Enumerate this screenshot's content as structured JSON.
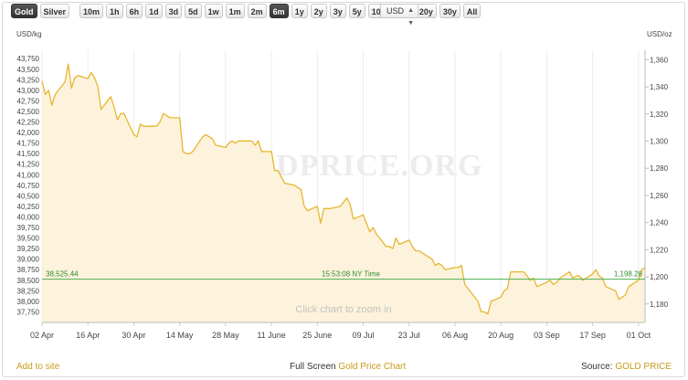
{
  "toolbar": {
    "metals": [
      {
        "label": "Gold",
        "active": true
      },
      {
        "label": "Silver",
        "active": false
      }
    ],
    "ranges": [
      {
        "label": "10m",
        "active": false
      },
      {
        "label": "1h",
        "active": false
      },
      {
        "label": "6h",
        "active": false
      },
      {
        "label": "1d",
        "active": false
      },
      {
        "label": "3d",
        "active": false
      },
      {
        "label": "5d",
        "active": false
      },
      {
        "label": "1w",
        "active": false
      },
      {
        "label": "1m",
        "active": false
      },
      {
        "label": "2m",
        "active": false
      },
      {
        "label": "6m",
        "active": true
      },
      {
        "label": "1y",
        "active": false
      },
      {
        "label": "2y",
        "active": false
      },
      {
        "label": "3y",
        "active": false
      },
      {
        "label": "5y",
        "active": false
      },
      {
        "label": "10y",
        "active": false
      },
      {
        "label": "15y",
        "active": false
      },
      {
        "label": "20y",
        "active": false
      },
      {
        "label": "30y",
        "active": false
      },
      {
        "label": "All",
        "active": false
      }
    ],
    "currency": "USD"
  },
  "footer": {
    "add_to_site": "Add to site",
    "full_screen": "Full Screen",
    "chart_link": "Gold Price Chart",
    "source_label": "Source:",
    "source_name": "GOLD PRICE"
  },
  "colors": {
    "line": "#e8b530",
    "fill": "#fdf3dc",
    "crosshair": "#4caf50",
    "crosshair_text": "#2e8b2e",
    "link": "#c79a1e",
    "watermark": "#ececec"
  },
  "chart_data": {
    "type": "area",
    "watermark": "GOLDPRICE.ORG",
    "hint": "Click chart to zoom in",
    "left_axis": {
      "unit": "USD/kg",
      "range": [
        37500,
        43950
      ],
      "ticks": [
        37750,
        38000,
        38250,
        38500,
        38750,
        39000,
        39250,
        39500,
        39750,
        40000,
        40250,
        40500,
        40750,
        41000,
        41250,
        41500,
        41750,
        42000,
        42250,
        42500,
        42750,
        43000,
        43250,
        43500,
        43750
      ],
      "tick_labels": [
        "37,750",
        "38,000",
        "38,250",
        "38,500",
        "38,750",
        "39,000",
        "39,250",
        "39,500",
        "39,750",
        "40,000",
        "40,250",
        "40,500",
        "40,750",
        "41,000",
        "41,250",
        "41,500",
        "41,750",
        "42,000",
        "42,250",
        "42,500",
        "42,750",
        "43,000",
        "43,250",
        "43,500",
        "43,750"
      ]
    },
    "right_axis": {
      "unit": "USD/oz",
      "ticks": [
        1180,
        1200,
        1220,
        1240,
        1260,
        1280,
        1300,
        1320,
        1340,
        1360
      ],
      "tick_labels": [
        "1,180",
        "1,200",
        "1,220",
        "1,240",
        "1,260",
        "1,280",
        "1,300",
        "1,320",
        "1,340",
        "1,360"
      ]
    },
    "x_axis": {
      "range": [
        "2018-04-02",
        "2018-10-03"
      ],
      "ticks": [
        "2018-04-02",
        "2018-04-16",
        "2018-04-30",
        "2018-05-14",
        "2018-05-28",
        "2018-06-11",
        "2018-06-25",
        "2018-07-09",
        "2018-07-23",
        "2018-08-06",
        "2018-08-20",
        "2018-09-03",
        "2018-09-17",
        "2018-10-01"
      ],
      "tick_labels": [
        "02 Apr",
        "16 Apr",
        "30 Apr",
        "14 May",
        "28 May",
        "11 June",
        "25 June",
        "09 Jul",
        "23 Jul",
        "06 Aug",
        "20 Aug",
        "03 Sep",
        "17 Sep",
        "01 Oct"
      ]
    },
    "grid": "vertical",
    "crosshair": {
      "left_label": "38,525.44",
      "time_label": "15:53:08 NY Time",
      "right_label": "1,198.28",
      "value": 38525.44
    },
    "series": [
      {
        "x": [
          "2018-04-02",
          "2018-04-03",
          "2018-04-04",
          "2018-04-05",
          "2018-04-06",
          "2018-04-09",
          "2018-04-10",
          "2018-04-11",
          "2018-04-12",
          "2018-04-13",
          "2018-04-16",
          "2018-04-17",
          "2018-04-18",
          "2018-04-19",
          "2018-04-20",
          "2018-04-23",
          "2018-04-24",
          "2018-04-25",
          "2018-04-26",
          "2018-04-27",
          "2018-04-30",
          "2018-05-01",
          "2018-05-02",
          "2018-05-03",
          "2018-05-04",
          "2018-05-07",
          "2018-05-08",
          "2018-05-09",
          "2018-05-10",
          "2018-05-11",
          "2018-05-14",
          "2018-05-15",
          "2018-05-16",
          "2018-05-17",
          "2018-05-18",
          "2018-05-21",
          "2018-05-22",
          "2018-05-23",
          "2018-05-24",
          "2018-05-25",
          "2018-05-28",
          "2018-05-29",
          "2018-05-30",
          "2018-05-31",
          "2018-06-01",
          "2018-06-04",
          "2018-06-05",
          "2018-06-06",
          "2018-06-07",
          "2018-06-08",
          "2018-06-11",
          "2018-06-12",
          "2018-06-13",
          "2018-06-14",
          "2018-06-15",
          "2018-06-18",
          "2018-06-19",
          "2018-06-20",
          "2018-06-21",
          "2018-06-22",
          "2018-06-25",
          "2018-06-26",
          "2018-06-27",
          "2018-06-28",
          "2018-06-29",
          "2018-07-02",
          "2018-07-03",
          "2018-07-04",
          "2018-07-05",
          "2018-07-06",
          "2018-07-09",
          "2018-07-10",
          "2018-07-11",
          "2018-07-12",
          "2018-07-13",
          "2018-07-16",
          "2018-07-17",
          "2018-07-18",
          "2018-07-19",
          "2018-07-20",
          "2018-07-23",
          "2018-07-24",
          "2018-07-25",
          "2018-07-26",
          "2018-07-27",
          "2018-07-30",
          "2018-07-31",
          "2018-08-01",
          "2018-08-02",
          "2018-08-03",
          "2018-08-06",
          "2018-08-07",
          "2018-08-08",
          "2018-08-09",
          "2018-08-10",
          "2018-08-13",
          "2018-08-14",
          "2018-08-15",
          "2018-08-16",
          "2018-08-17",
          "2018-08-20",
          "2018-08-21",
          "2018-08-22",
          "2018-08-23",
          "2018-08-24",
          "2018-08-27",
          "2018-08-28",
          "2018-08-29",
          "2018-08-30",
          "2018-08-31",
          "2018-09-03",
          "2018-09-04",
          "2018-09-05",
          "2018-09-06",
          "2018-09-07",
          "2018-09-10",
          "2018-09-11",
          "2018-09-12",
          "2018-09-13",
          "2018-09-14",
          "2018-09-17",
          "2018-09-18",
          "2018-09-19",
          "2018-09-20",
          "2018-09-21",
          "2018-09-24",
          "2018-09-25",
          "2018-09-26",
          "2018-09-27",
          "2018-09-28",
          "2018-10-01",
          "2018-10-02",
          "2018-10-03"
        ],
        "values": [
          43220,
          42900,
          43000,
          42650,
          42900,
          43200,
          43620,
          43050,
          43300,
          43350,
          43280,
          43420,
          43300,
          43100,
          42550,
          42850,
          42600,
          42300,
          42450,
          42450,
          41950,
          41900,
          42200,
          42150,
          42150,
          42150,
          42250,
          42450,
          42400,
          42350,
          42350,
          41550,
          41500,
          41500,
          41550,
          41900,
          41950,
          41900,
          41850,
          41700,
          41650,
          41750,
          41800,
          41750,
          41800,
          41800,
          41800,
          41700,
          41800,
          41550,
          41550,
          41100,
          41100,
          40950,
          40800,
          40750,
          40700,
          40650,
          40250,
          40150,
          40250,
          39850,
          40200,
          40200,
          40200,
          40250,
          40350,
          40450,
          40300,
          39950,
          40050,
          39850,
          39650,
          39750,
          39600,
          39300,
          39300,
          39250,
          39500,
          39350,
          39450,
          39300,
          39200,
          39200,
          39150,
          39000,
          38850,
          38900,
          38850,
          38750,
          38800,
          38800,
          38850,
          38400,
          38300,
          38000,
          37750,
          37750,
          37700,
          38000,
          38100,
          38250,
          38300,
          38700,
          38700,
          38700,
          38600,
          38500,
          38550,
          38350,
          38450,
          38500,
          38400,
          38450,
          38550,
          38700,
          38550,
          38600,
          38600,
          38500,
          38650,
          38750,
          38600,
          38550,
          38350,
          38250,
          38050,
          38100,
          38150,
          38350,
          38500,
          38750,
          38800
        ]
      }
    ]
  }
}
